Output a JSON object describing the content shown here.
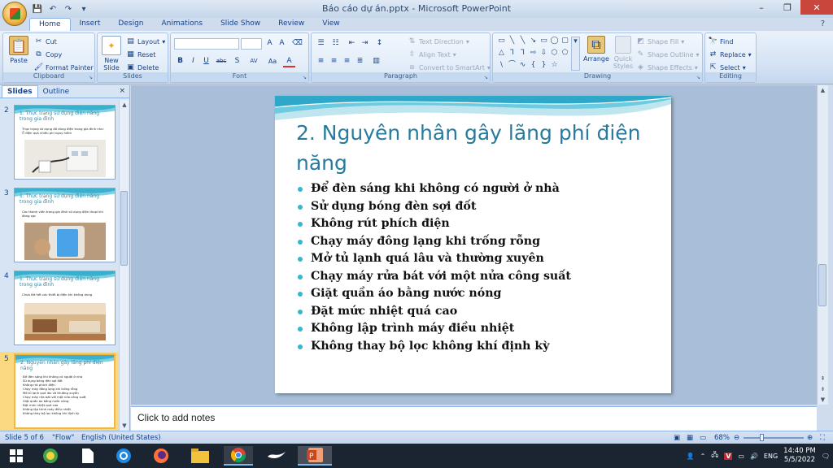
{
  "window": {
    "title": "Báo cáo dự án.pptx - Microsoft PowerPoint",
    "controls": [
      "–",
      "❐",
      "✕"
    ]
  },
  "ribbon_tabs": [
    "Home",
    "Insert",
    "Design",
    "Animations",
    "Slide Show",
    "Review",
    "View"
  ],
  "ribbon": {
    "clipboard": {
      "label": "Clipboard",
      "paste": "Paste",
      "cut": "Cut",
      "copy": "Copy",
      "format_painter": "Format Painter"
    },
    "slides": {
      "label": "Slides",
      "new_slide": "New Slide",
      "layout": "Layout",
      "reset": "Reset",
      "delete": "Delete"
    },
    "font": {
      "label": "Font",
      "font_name": "",
      "font_size": "",
      "buttons": [
        "B",
        "I",
        "U",
        "abc",
        "S",
        "AV",
        "Aa",
        "A"
      ]
    },
    "paragraph": {
      "label": "Paragraph",
      "text_direction": "Text Direction",
      "align_text": "Align Text",
      "convert_smartart": "Convert to SmartArt"
    },
    "drawing": {
      "label": "Drawing",
      "arrange": "Arrange",
      "quick_styles": "Quick Styles",
      "shape_fill": "Shape Fill",
      "shape_outline": "Shape Outline",
      "shape_effects": "Shape Effects"
    },
    "editing": {
      "label": "Editing",
      "find": "Find",
      "replace": "Replace",
      "select": "Select"
    }
  },
  "panel": {
    "tabs": [
      "Slides",
      "Outline"
    ],
    "close": "×",
    "thumbnails": [
      {
        "num": "2",
        "title": "1. Thực trạng sử dụng điện năng trong gia đình",
        "bullets": [
          "Thực trạng sử dụng đồ dùng điện trong gia đình như:",
          "Ổ điện quá nhiều phí nguy hiểm"
        ],
        "image": "appliance-photo"
      },
      {
        "num": "3",
        "title": "1. Thực trạng sử dụng điện năng trong gia đình",
        "bullets": [
          "Các thành viên trong gia đình sử dụng điện thoại khi đang sạc"
        ],
        "image": "phone-photo"
      },
      {
        "num": "4",
        "title": "1. Thực trạng sử dụng điện năng trong gia đình",
        "bullets": [
          "Chưa tắt hết các thiết bị điện khi không dùng"
        ],
        "image": "living-room-photo"
      },
      {
        "num": "5",
        "title": "2. Nguyên nhân gây lãng phí điện năng",
        "bullets": [
          "Để đèn sáng khi không có người ở nhà",
          "Sử dụng bóng đèn sợi đốt",
          "Không rút phích điện",
          "Chạy máy đông lạng khi trống rỗng",
          "Mở tủ lạnh quá lâu và thường xuyên",
          "Chạy máy rửa bát với một nửa công suất",
          "Giặt quần áo bằng nước nóng",
          "Đặt mức nhiệt quá cao",
          "Không lập trình máy điều nhiệt",
          "Không thay bộ lọc không khí định kỳ"
        ],
        "image": ""
      }
    ]
  },
  "slide": {
    "title": "2. Nguyên nhân gây lãng phí điện năng",
    "bullets": [
      "Để đèn sáng khi không có người ở nhà",
      "Sử dụng bóng đèn sợi đốt",
      "Không rút phích điện",
      "Chạy máy đông lạng khi trống rỗng",
      " Mở tủ lạnh quá lâu và thường xuyên",
      "Chạy máy rửa bát với một nửa công suất",
      "Giặt quần áo bằng nước nóng",
      "Đặt mức nhiệt quá cao",
      "Không lập trình máy điều nhiệt",
      "Không thay bộ lọc không khí định kỳ"
    ]
  },
  "notes": {
    "placeholder": "Click to add notes"
  },
  "status": {
    "slide_info": "Slide 5 of 6",
    "theme": "\"Flow\"",
    "language": "English (United States)",
    "zoom": "68%"
  },
  "taskbar": {
    "apps": [
      "windows-start",
      "app-launcher",
      "file",
      "browser-blue",
      "firefox",
      "file-explorer",
      "chrome",
      "app-bird",
      "powerpoint"
    ],
    "ime": "ENG",
    "time": "14:40 PM",
    "date": "5/5/2022"
  },
  "colors": {
    "accent": "#287b9e",
    "bullet": "#35b7d2",
    "ribbon": "#d2e1f4"
  }
}
